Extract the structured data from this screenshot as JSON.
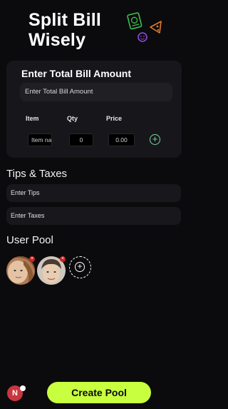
{
  "header": {
    "title": "Split Bill\nWisely"
  },
  "bill": {
    "heading": "Enter Total Bill Amount",
    "total_placeholder": "Enter Total Bill Amount",
    "columns": {
      "item": "Item",
      "qty": "Qty",
      "price": "Price"
    },
    "row": {
      "item_placeholder": "Item na",
      "qty_value": "0",
      "price_value": "0.00"
    }
  },
  "tips_taxes": {
    "heading": "Tips & Taxes",
    "tips_placeholder": "Enter Tips",
    "taxes_placeholder": "Enter Taxes"
  },
  "user_pool": {
    "heading": "User Pool",
    "users": [
      {
        "icon": "user-photo-1"
      },
      {
        "icon": "user-photo-2"
      }
    ]
  },
  "footer": {
    "current_user_initial": "N",
    "create_button": "Create Pool"
  },
  "colors": {
    "accent": "#c8ff3e",
    "success": "#7fd7a2",
    "danger": "#c22222",
    "deco_green": "#3cc24a",
    "deco_orange": "#e07b2e",
    "deco_purple": "#8c4bd8"
  }
}
